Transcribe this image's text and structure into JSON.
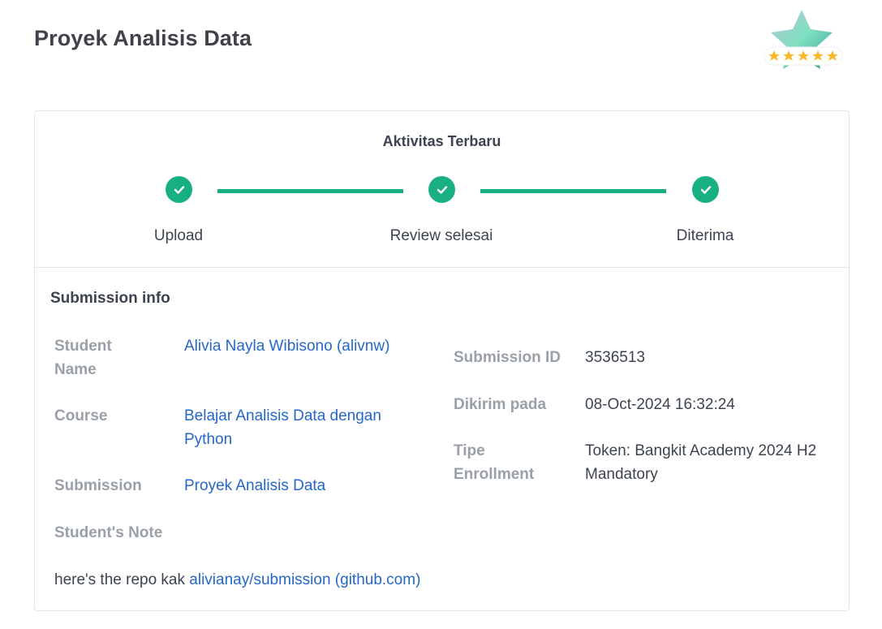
{
  "header": {
    "title": "Proyek Analisis Data"
  },
  "activity": {
    "title": "Aktivitas Terbaru",
    "steps": [
      {
        "label": "Upload"
      },
      {
        "label": "Review selesai"
      },
      {
        "label": "Diterima"
      }
    ],
    "accent_color": "#18b082"
  },
  "submission_info": {
    "title": "Submission info",
    "left": {
      "student_name_label": "Student Name",
      "student_name_value": "Alivia Nayla Wibisono (alivnw)",
      "course_label": "Course",
      "course_value": "Belajar Analisis Data dengan Python",
      "submission_label": "Submission",
      "submission_value": "Proyek Analisis Data",
      "note_label": "Student's Note",
      "note_prefix": "here's the repo kak ",
      "note_link": "alivianay/submission (github.com)"
    },
    "right": {
      "submission_id_label": "Submission ID",
      "submission_id_value": "3536513",
      "sent_at_label": "Dikirim pada",
      "sent_at_value": "08-Oct-2024 16:32:24",
      "enrollment_label": "Tipe Enrollment",
      "enrollment_value": "Token: Bangkit Academy 2024 H2 Mandatory"
    }
  },
  "colors": {
    "link": "#2567c8",
    "label": "#9aa0a8",
    "text": "#3d4450"
  },
  "icons": {
    "badge": "star-rating-badge-icon",
    "step": "check-circle-icon"
  }
}
